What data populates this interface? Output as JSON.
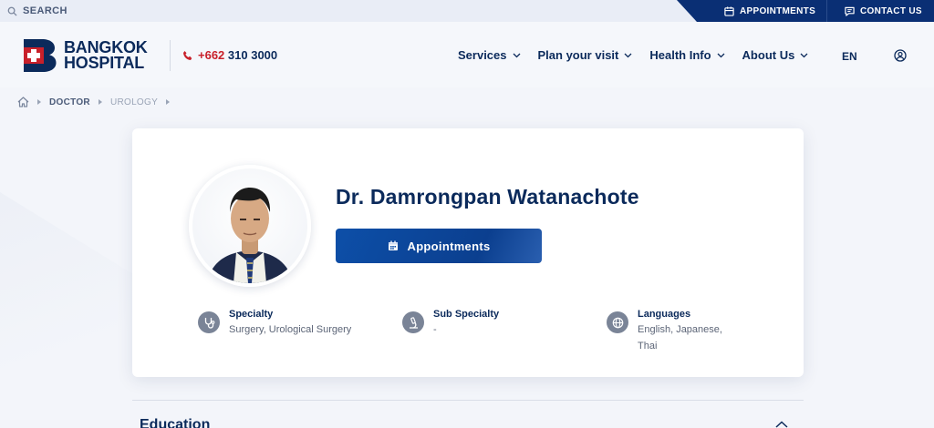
{
  "topbar": {
    "search_label": "SEARCH",
    "appointments_label": "APPOINTMENTS",
    "contact_label": "CONTACT US"
  },
  "header": {
    "logo_line1": "BANGKOK",
    "logo_line2": "HOSPITAL",
    "phone_prefix": "+662",
    "phone_number": " 310 3000",
    "nav": [
      {
        "label": "Services"
      },
      {
        "label": "Plan your visit"
      },
      {
        "label": "Health Info"
      },
      {
        "label": "About Us"
      }
    ],
    "language": "EN"
  },
  "breadcrumb": {
    "level1": "DOCTOR",
    "level2": "UROLOGY"
  },
  "doctor": {
    "name": "Dr. Damrongpan Watanachote",
    "appointment_button": "Appointments",
    "specialty_label": "Specialty",
    "specialty_value": "Surgery, Urological Surgery",
    "sub_specialty_label": "Sub Specialty",
    "sub_specialty_value": "-",
    "languages_label": "Languages",
    "languages_value": "English, Japanese, Thai"
  },
  "sections": {
    "education_title": "Education"
  },
  "colors": {
    "navy": "#0b2a5b",
    "brand_blue": "#0a2f74",
    "button_blue": "#0d4fa8",
    "brand_red": "#c8202a",
    "background": "#f3f5fa"
  },
  "icons": [
    "search-icon",
    "calendar-icon",
    "chat-icon",
    "phone-icon",
    "chevron-down-icon",
    "user-icon",
    "home-icon",
    "stethoscope-icon",
    "microscope-icon",
    "globe-icon"
  ]
}
